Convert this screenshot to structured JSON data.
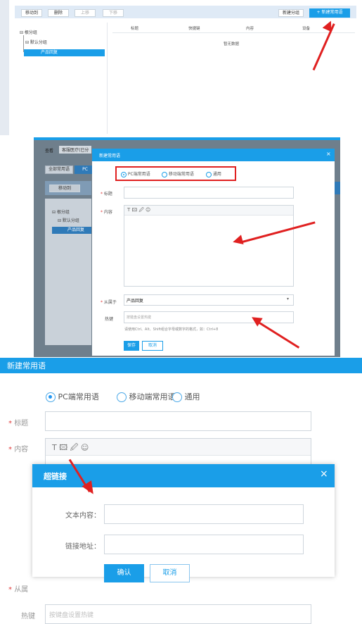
{
  "s1": {
    "toolbar": {
      "move": "移动到",
      "delete": "删除",
      "up": "上移",
      "down": "下移",
      "new_group": "新建分组",
      "new_phrase": "+ 新建常用语"
    },
    "tree": {
      "root": "⊟ 根分组",
      "child": "⊟ 默认分组",
      "leaf": "产品回复"
    },
    "columns": [
      "标题",
      "快捷键",
      "内容",
      "设备"
    ],
    "empty": "暂无数据"
  },
  "s2": {
    "bg_view": "查看",
    "bg_select": "客服医疗(已分",
    "bg_tab_all": "全部常用语",
    "bg_tab_pc": "PC",
    "bg_move": "移动到",
    "bg_tree_root": "⊟ 根分组",
    "bg_tree_child": "⊟ 默认分组",
    "bg_tree_leaf": "产品回复",
    "dialog_title": "新建常用语",
    "close": "×",
    "radios": [
      "PC端常用语",
      "移动端常用语",
      "通用"
    ],
    "title_label": "标题",
    "content_label": "内容",
    "toolbar_glyphs": "T 🖾 🖉 ☺",
    "belongs_label": "从属于",
    "belongs_value": "产品回复",
    "hotkey_label": "热键",
    "hotkey_placeholder": "按键盘设置热键",
    "hotkey_hint": "请使用Ctrl、Alt、Shift组合字母或数字的格式，如：Ctrl+8",
    "save": "保存",
    "cancel": "取消"
  },
  "s3": {
    "header": "新建常用语",
    "radios": [
      "PC端常用语",
      "移动端常用语",
      "通用"
    ],
    "title_label": "标题",
    "content_label": "内容",
    "toolbar_glyphs": "T 🖾 🖉 ☺",
    "belongs_label": "从属",
    "hotkey_label": "热键",
    "hotkey_placeholder": "按键盘设置热键",
    "link_dialog": {
      "title": "超链接",
      "close": "×",
      "text_label": "文本内容：",
      "url_label": "链接地址：",
      "confirm": "确认",
      "cancel": "取消"
    }
  },
  "colors": {
    "accent": "#1a9ee8",
    "highlight": "#e02020",
    "sidebar": "#e5eaf1"
  }
}
